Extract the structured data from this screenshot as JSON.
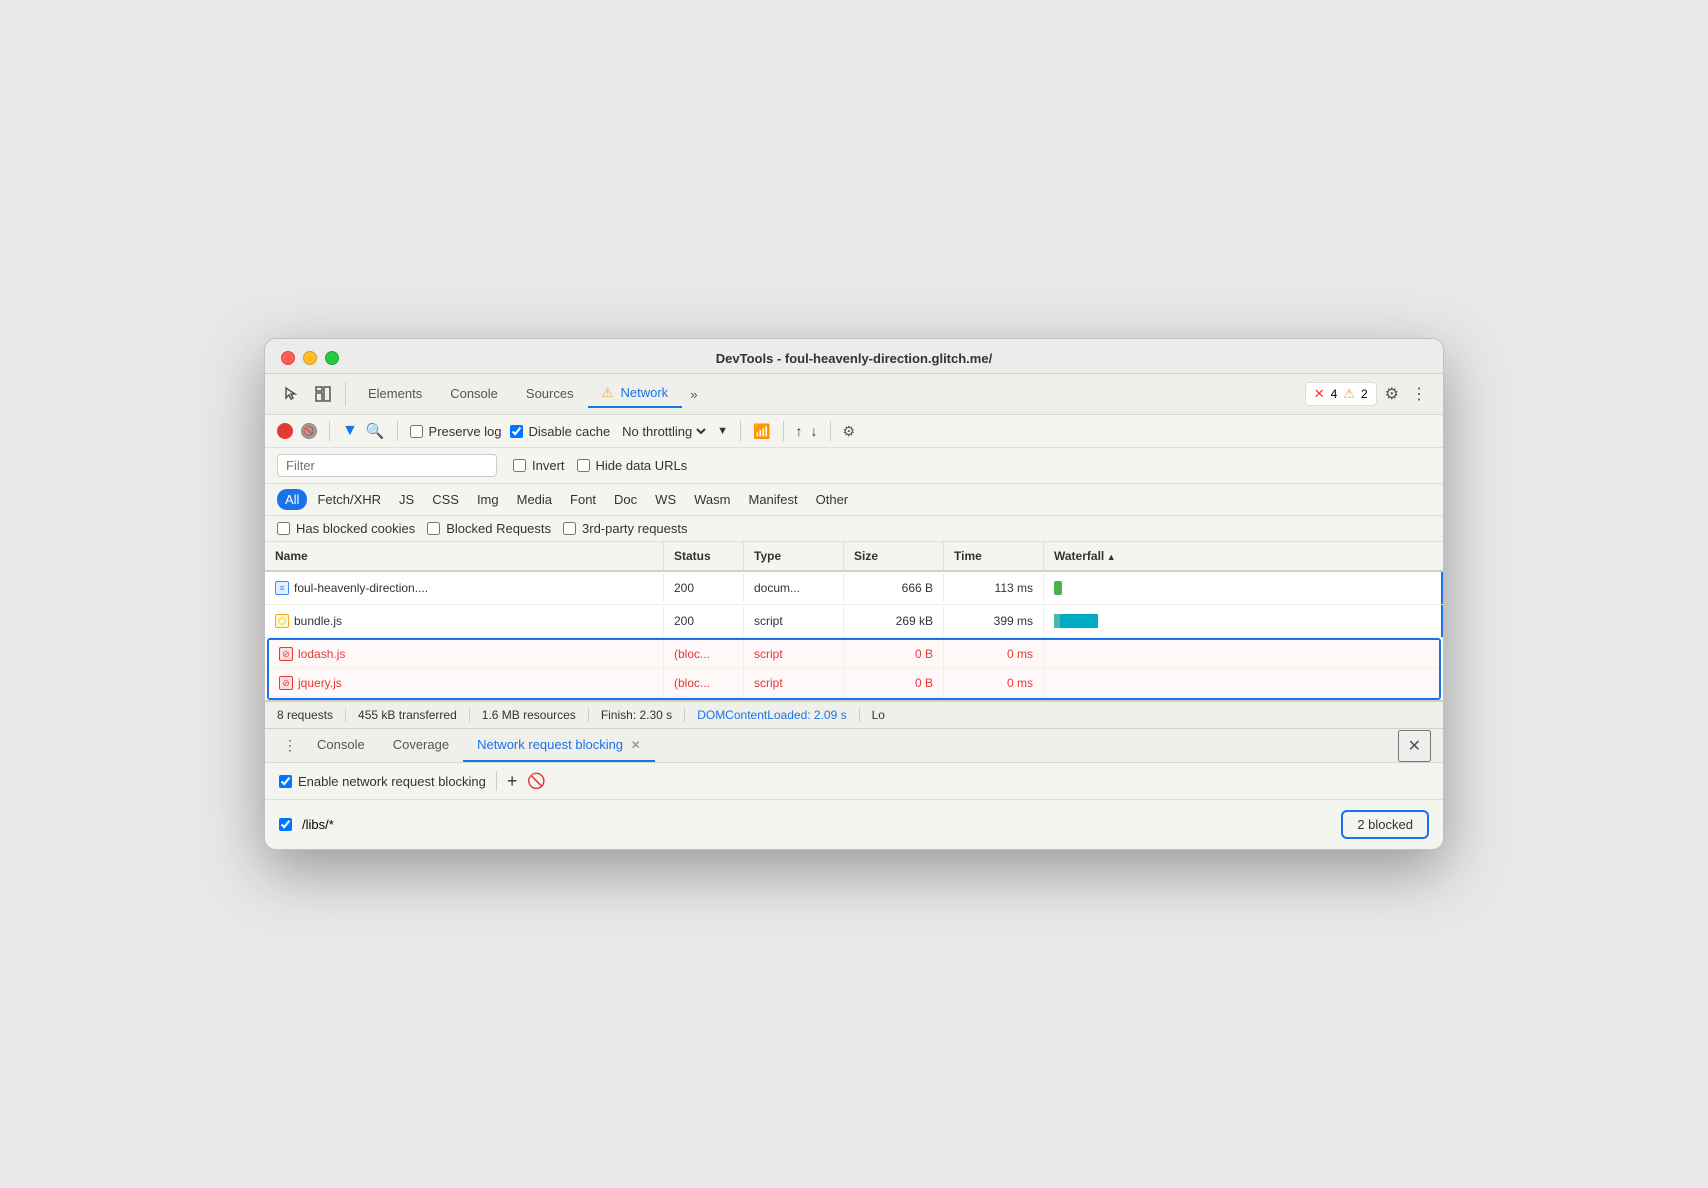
{
  "window": {
    "title": "DevTools - foul-heavenly-direction.glitch.me/"
  },
  "tabs": {
    "items": [
      {
        "label": "Elements",
        "active": false
      },
      {
        "label": "Console",
        "active": false
      },
      {
        "label": "Sources",
        "active": false
      },
      {
        "label": "⚠ Network",
        "active": true
      },
      {
        "label": "»",
        "active": false
      }
    ]
  },
  "error_badge": {
    "error_count": "4",
    "warn_count": "2"
  },
  "network_toolbar": {
    "preserve_log_label": "Preserve log",
    "disable_cache_label": "Disable cache",
    "no_throttling_label": "No throttling"
  },
  "filter": {
    "placeholder": "Filter",
    "invert_label": "Invert",
    "hide_data_urls_label": "Hide data URLs"
  },
  "type_filters": [
    "All",
    "Fetch/XHR",
    "JS",
    "CSS",
    "Img",
    "Media",
    "Font",
    "Doc",
    "WS",
    "Wasm",
    "Manifest",
    "Other"
  ],
  "cookie_filters": [
    {
      "label": "Has blocked cookies"
    },
    {
      "label": "Blocked Requests"
    },
    {
      "label": "3rd-party requests"
    }
  ],
  "table": {
    "headers": [
      "Name",
      "Status",
      "Type",
      "Size",
      "Time",
      "Waterfall"
    ],
    "rows": [
      {
        "name": "foul-heavenly-direction....",
        "status": "200",
        "type": "docum...",
        "size": "666 B",
        "time": "113 ms",
        "icon": "doc",
        "blocked": false
      },
      {
        "name": "bundle.js",
        "status": "200",
        "type": "script",
        "size": "269 kB",
        "time": "399 ms",
        "icon": "script",
        "blocked": false
      },
      {
        "name": "lodash.js",
        "status": "(bloc...",
        "type": "script",
        "size": "0 B",
        "time": "0 ms",
        "icon": "script-blocked",
        "blocked": true
      },
      {
        "name": "jquery.js",
        "status": "(bloc...",
        "type": "script",
        "size": "0 B",
        "time": "0 ms",
        "icon": "script-blocked",
        "blocked": true
      }
    ]
  },
  "status_bar": {
    "requests": "8 requests",
    "transferred": "455 kB transferred",
    "resources": "1.6 MB resources",
    "finish": "Finish: 2.30 s",
    "dom_loaded": "DOMContentLoaded: 2.09 s",
    "load": "Lo"
  },
  "bottom_panel": {
    "tabs": [
      {
        "label": "Console",
        "active": false,
        "closable": false
      },
      {
        "label": "Coverage",
        "active": false,
        "closable": false
      },
      {
        "label": "Network request blocking",
        "active": true,
        "closable": true
      }
    ],
    "enable_label": "Enable network request blocking",
    "rule": "/libs/*",
    "blocked_badge": "2 blocked"
  }
}
